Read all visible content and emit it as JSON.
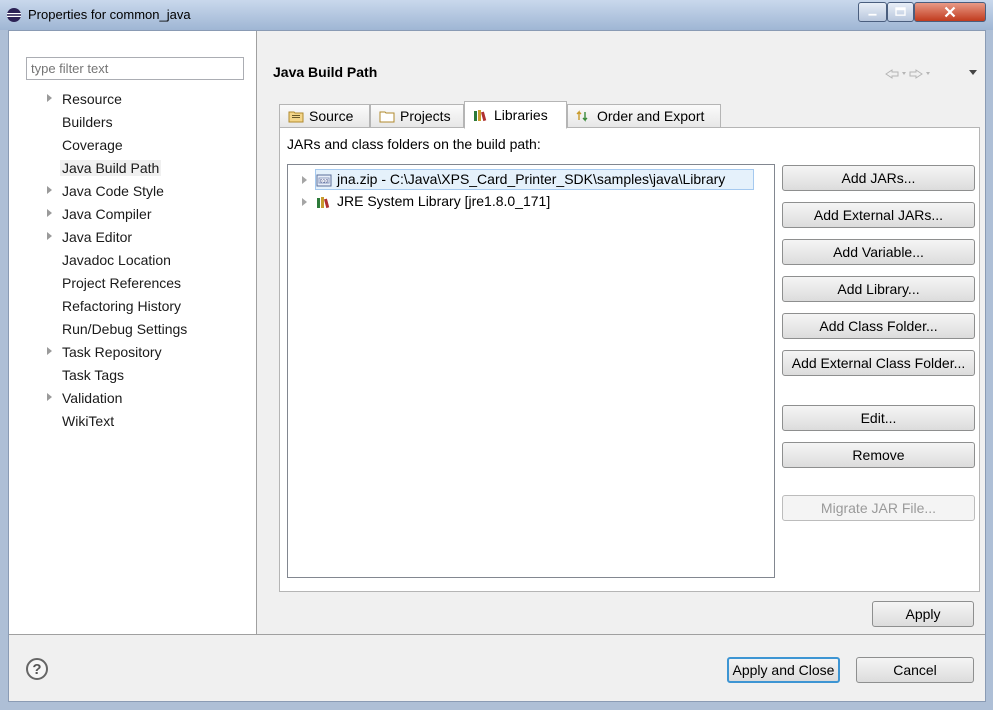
{
  "window": {
    "title": "Properties for common_java",
    "controls": [
      "minimize-icon",
      "maximize-icon",
      "close-icon"
    ]
  },
  "filter": {
    "placeholder": "type filter text"
  },
  "nav": {
    "items": [
      {
        "label": "Resource",
        "expandable": true
      },
      {
        "label": "Builders",
        "expandable": false
      },
      {
        "label": "Coverage",
        "expandable": false
      },
      {
        "label": "Java Build Path",
        "expandable": false,
        "selected": true
      },
      {
        "label": "Java Code Style",
        "expandable": true
      },
      {
        "label": "Java Compiler",
        "expandable": true
      },
      {
        "label": "Java Editor",
        "expandable": true
      },
      {
        "label": "Javadoc Location",
        "expandable": false
      },
      {
        "label": "Project References",
        "expandable": false
      },
      {
        "label": "Refactoring History",
        "expandable": false
      },
      {
        "label": "Run/Debug Settings",
        "expandable": false
      },
      {
        "label": "Task Repository",
        "expandable": true
      },
      {
        "label": "Task Tags",
        "expandable": false
      },
      {
        "label": "Validation",
        "expandable": true
      },
      {
        "label": "WikiText",
        "expandable": false
      }
    ]
  },
  "page": {
    "title": "Java Build Path",
    "tabs": [
      {
        "label": "Source",
        "icon": "source-folder-icon"
      },
      {
        "label": "Projects",
        "icon": "projects-icon"
      },
      {
        "label": "Libraries",
        "icon": "libraries-icon",
        "active": true
      },
      {
        "label": "Order and Export",
        "icon": "order-export-icon"
      }
    ],
    "panel_label": "JARs and class folders on the build path:",
    "entries": [
      {
        "label": "jna.zip - C:\\Java\\XPS_Card_Printer_SDK\\samples\\java\\Library",
        "icon": "archive-icon",
        "selected": true
      },
      {
        "label": "JRE System Library [jre1.8.0_171]",
        "icon": "library-icon"
      }
    ],
    "buttons": [
      {
        "label": "Add JARs...",
        "enabled": true
      },
      {
        "label": "Add External JARs...",
        "enabled": true
      },
      {
        "label": "Add Variable...",
        "enabled": true
      },
      {
        "label": "Add Library...",
        "enabled": true
      },
      {
        "label": "Add Class Folder...",
        "enabled": true
      },
      {
        "label": "Add External Class Folder...",
        "enabled": true
      },
      {
        "label": "Edit...",
        "enabled": true
      },
      {
        "label": "Remove",
        "enabled": true
      },
      {
        "label": "Migrate JAR File...",
        "enabled": false
      }
    ],
    "apply_label": "Apply"
  },
  "footer": {
    "help_symbol": "?",
    "apply_close_label": "Apply and Close",
    "cancel_label": "Cancel"
  }
}
